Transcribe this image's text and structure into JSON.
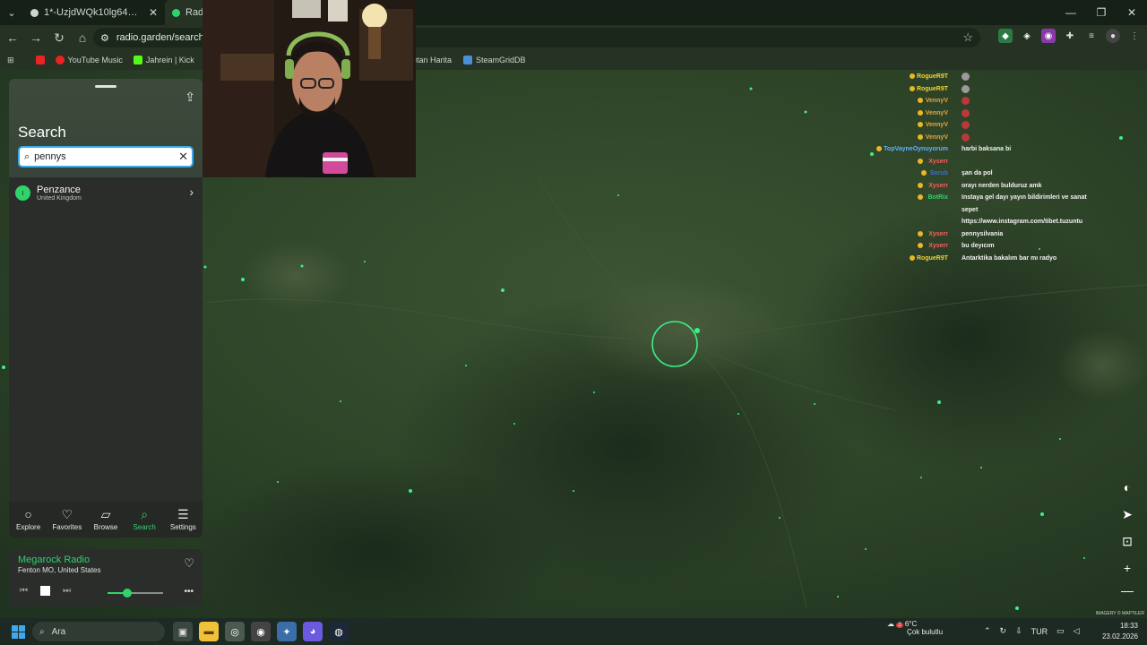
{
  "browser": {
    "tabs": [
      {
        "title": "1*-UzjdWQk10lg64ZnFKhj3g.png"
      },
      {
        "title": "Radio"
      }
    ],
    "url": "radio.garden/search",
    "bookmarks": [
      {
        "label": "YouTube Music"
      },
      {
        "label": "Jahrein | Kick"
      },
      {
        "label": "lutan Harita"
      },
      {
        "label": "SteamGridDB"
      }
    ]
  },
  "panel": {
    "title": "Search",
    "search_value": "pennys",
    "results": [
      {
        "name": "Penzance",
        "country": "United Kingdom"
      }
    ],
    "nav": [
      {
        "label": "Explore"
      },
      {
        "label": "Favorites"
      },
      {
        "label": "Browse"
      },
      {
        "label": "Search"
      },
      {
        "label": "Settings"
      }
    ],
    "active_nav": "Search"
  },
  "player": {
    "station": "Megarock Radio",
    "location": "Fenton MO, United States",
    "volume_fraction": 0.35
  },
  "chat": [
    {
      "user": "RogueR9T",
      "color": "#f2d233",
      "message": "",
      "emote": "grey"
    },
    {
      "user": "RogueR9T",
      "color": "#f2d233",
      "message": "",
      "emote": "grey"
    },
    {
      "user": "VennyV",
      "color": "#e8a23c",
      "message": "",
      "emote": "red"
    },
    {
      "user": "VennyV",
      "color": "#e8a23c",
      "message": "",
      "emote": "red"
    },
    {
      "user": "VennyV",
      "color": "#e8a23c",
      "message": "",
      "emote": "red"
    },
    {
      "user": "VennyV",
      "color": "#e8a23c",
      "message": "",
      "emote": "red"
    },
    {
      "user": "TopVayneOynuyorum",
      "color": "#5fb0ff",
      "message": "harbi baksana bi",
      "emote": ""
    },
    {
      "user": "Xyserr",
      "color": "#ff5c5c",
      "message": "",
      "emote": ""
    },
    {
      "user": "Sorub",
      "color": "#3b6fd8",
      "message": "şan da pol",
      "emote": ""
    },
    {
      "user": "Xyserr",
      "color": "#ff5c5c",
      "message": "orayı nerden bulduruz amk",
      "emote": ""
    },
    {
      "user": "BotRix",
      "color": "#2fd36a",
      "message": "Instaya gel dayı yayın bildirimleri ve sanat",
      "emote": ""
    },
    {
      "user": "",
      "color": "#ffffff",
      "message": "sepet",
      "emote": ""
    },
    {
      "user": "",
      "color": "#ffffff",
      "message": "https://www.instagram.com/tibet.tuzuntu",
      "emote": ""
    },
    {
      "user": "Xyserr",
      "color": "#ff5c5c",
      "message": "pennysilvania",
      "emote": ""
    },
    {
      "user": "Xyserr",
      "color": "#ff5c5c",
      "message": "bu deyıcım",
      "emote": ""
    },
    {
      "user": "RogueR9T",
      "color": "#f2d233",
      "message": "Antarktika bakalım bar mı radyo",
      "emote": ""
    }
  ],
  "map_attribution": "IMAGERY © MAPTILER",
  "taskbar": {
    "search_placeholder": "Ara",
    "weather_temp": "6°C",
    "weather_desc": "Çok bulutlu",
    "weather_badge": "2",
    "lang": "TUR",
    "time": "18:33",
    "date": "23.02.2026"
  },
  "colors": {
    "accent": "#2fd36a",
    "search_border": "#3aa9e8"
  }
}
